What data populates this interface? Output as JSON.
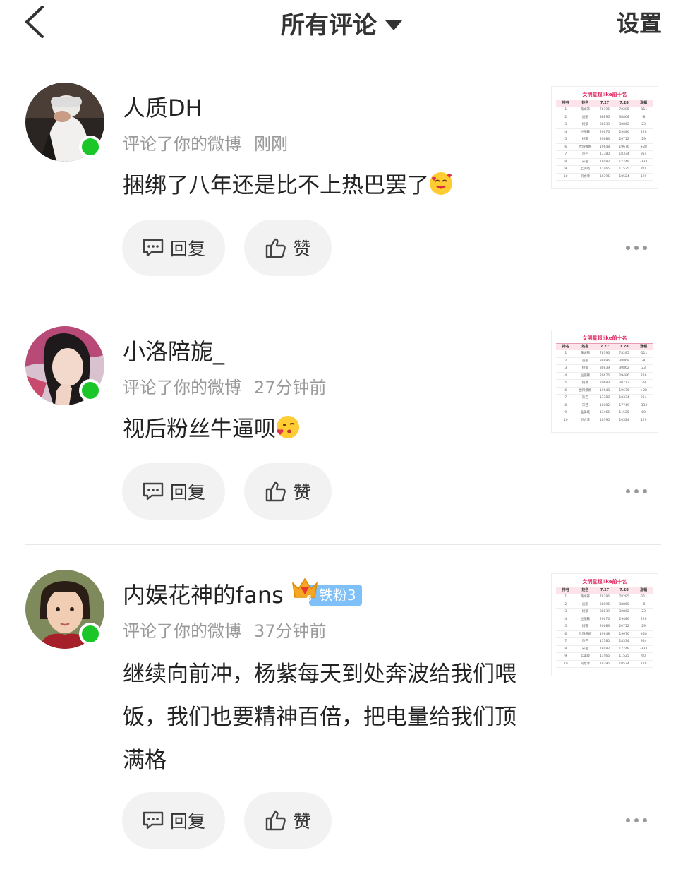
{
  "header": {
    "title": "所有评论",
    "settings_label": "设置",
    "icons": {
      "back": "back-chevron-icon",
      "dropdown": "dropdown-triangle-icon"
    }
  },
  "thumbnail_table": {
    "title": "女明星超like前十名",
    "columns": [
      "排名",
      "姓名",
      "7.27",
      "7.28",
      "涨幅"
    ],
    "rows": [
      [
        "1",
        "鞠婧祎",
        "78396",
        "78285",
        "-111"
      ],
      [
        "2",
        "迪丽",
        "38896",
        "38868",
        "-8"
      ],
      [
        "3",
        "杨紫",
        "30839",
        "30862",
        "23"
      ],
      [
        "4",
        "赵丽颖",
        "29676",
        "29486",
        "226"
      ],
      [
        "5",
        "杨幂",
        "20683",
        "20712",
        "29"
      ],
      [
        "6",
        "欧阳娜娜",
        "19648",
        "19676",
        "+28"
      ],
      [
        "7",
        "热巴",
        "17380",
        "18334",
        "954"
      ],
      [
        "8",
        "宋茜",
        "18082",
        "17749",
        "-333"
      ],
      [
        "9",
        "孟美岐",
        "11465",
        "11525",
        "60"
      ],
      [
        "10",
        "刘亦菲",
        "10395",
        "10524",
        "129"
      ]
    ]
  },
  "comments": [
    {
      "username": "人质DH",
      "action": "评论了你的微博",
      "time": "刚刚",
      "text": "捆绑了八年还是比不上热巴罢了",
      "emoji": "smiling-face-with-hearts-emoji",
      "reply_label": "回复",
      "like_label": "赞"
    },
    {
      "username": "小洛陪旎_",
      "action": "评论了你的微博",
      "time": "27分钟前",
      "text": "视后粉丝牛逼呗",
      "emoji": "face-blowing-kiss-emoji",
      "reply_label": "回复",
      "like_label": "赞"
    },
    {
      "username": "内娱花神的fans",
      "badge": {
        "level": "6",
        "label": "铁粉3",
        "color": "#7ec0f7"
      },
      "action": "评论了你的微博",
      "time": "37分钟前",
      "text": "继续向前冲，杨紫每天到处奔波给我们喂饭，我们也要精神百倍，把电量给我们顶满格",
      "reply_label": "回复",
      "like_label": "赞"
    }
  ],
  "colors": {
    "online": "#1bc629",
    "button_bg": "#f2f2f2",
    "meta_text": "#9a9a9a"
  }
}
